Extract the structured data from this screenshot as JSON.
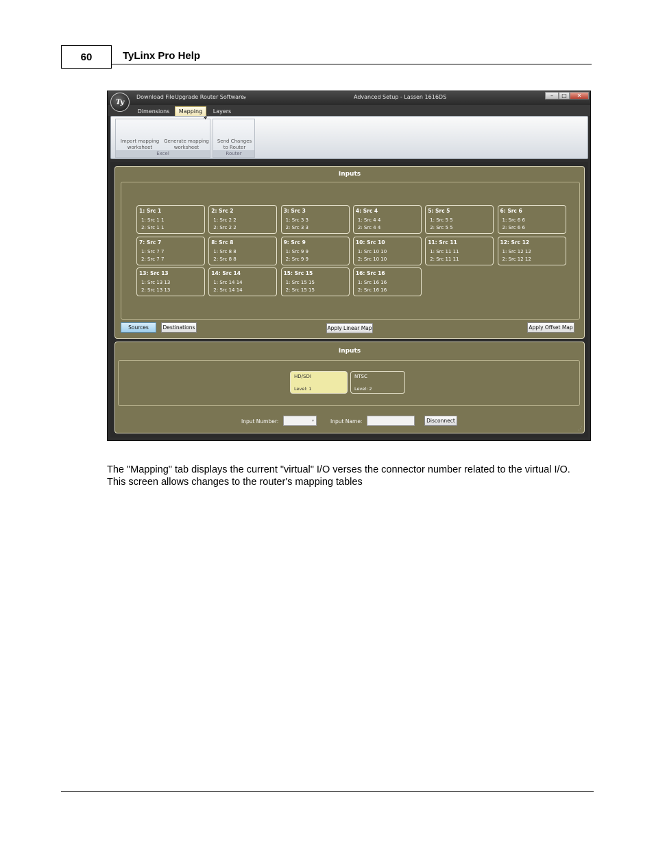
{
  "header": {
    "page_number": "60",
    "title": "TyLinx Pro Help"
  },
  "window": {
    "title": "Advanced Setup - Lassen 1616DS",
    "orb_text": "Ty",
    "quick_access": [
      "Download File",
      "Upgrade Router Software"
    ],
    "controls": {
      "minimize": "–",
      "maximize": "□",
      "close": "✕"
    },
    "tabs": [
      "Dimensions",
      "Mapping",
      "Layers"
    ],
    "active_tab": "Mapping",
    "ribbon": {
      "excel": {
        "label": "Excel",
        "import_line1": "Import mapping",
        "import_line2": "worksheet",
        "generate_line1": "Generate mapping",
        "generate_line2": "worksheet"
      },
      "router": {
        "label": "Router",
        "send_line1": "Send Changes",
        "send_line2": "to Router"
      }
    },
    "inputs_panel": {
      "title": "Inputs",
      "cards": [
        {
          "name": "1: Src 1",
          "line1": "1: Src 1   1",
          "line2": "2: Src 1   1"
        },
        {
          "name": "2: Src 2",
          "line1": "1: Src 2   2",
          "line2": "2: Src 2   2"
        },
        {
          "name": "3: Src 3",
          "line1": "1: Src 3   3",
          "line2": "2: Src 3   3"
        },
        {
          "name": "4: Src 4",
          "line1": "1: Src 4   4",
          "line2": "2: Src 4   4"
        },
        {
          "name": "5: Src 5",
          "line1": "1: Src 5   5",
          "line2": "2: Src 5   5"
        },
        {
          "name": "6: Src 6",
          "line1": "1: Src 6   6",
          "line2": "2: Src 6   6"
        },
        {
          "name": "7: Src 7",
          "line1": "1: Src 7   7",
          "line2": "2: Src 7   7"
        },
        {
          "name": "8: Src 8",
          "line1": "1: Src 8   8",
          "line2": "2: Src 8   8"
        },
        {
          "name": "9: Src 9",
          "line1": "1: Src 9   9",
          "line2": "2: Src 9   9"
        },
        {
          "name": "10: Src 10",
          "line1": "1: Src 10   10",
          "line2": "2: Src 10   10"
        },
        {
          "name": "11: Src 11",
          "line1": "1: Src 11   11",
          "line2": "2: Src 11   11"
        },
        {
          "name": "12: Src 12",
          "line1": "1: Src 12   12",
          "line2": "2: Src 12   12"
        },
        {
          "name": "13: Src 13",
          "line1": "1: Src 13   13",
          "line2": "2: Src 13   13"
        },
        {
          "name": "14: Src 14",
          "line1": "1: Src 14   14",
          "line2": "2: Src 14   14"
        },
        {
          "name": "15: Src 15",
          "line1": "1: Src 15   15",
          "line2": "2: Src 15   15"
        },
        {
          "name": "16: Src 16",
          "line1": "1: Src 16   16",
          "line2": "2: Src 16   16"
        }
      ],
      "sources_button": "Sources",
      "destinations_button": "Destinations",
      "apply_linear": "Apply Linear Map",
      "apply_offset": "Apply Offset Map"
    },
    "levels_panel": {
      "title": "Inputs",
      "levels": [
        {
          "name": "HD/SDI",
          "level": "Level: 1",
          "selected": true
        },
        {
          "name": "NTSC",
          "level": "Level: 2",
          "selected": false
        }
      ],
      "input_number_label": "Input Number:",
      "input_name_label": "Input Name:",
      "disconnect_button": "Disconnect"
    }
  },
  "body": {
    "paragraph1": "The \"Mapping\" tab displays the current \"virtual\" I/O verses the connector number related to the virtual I/O.",
    "paragraph2": "This screen allows changes to the router's mapping tables"
  },
  "colors": {
    "panel_olive": "#7a7553",
    "selected_level": "#efeaa6",
    "active_button": "#9fcfec"
  }
}
